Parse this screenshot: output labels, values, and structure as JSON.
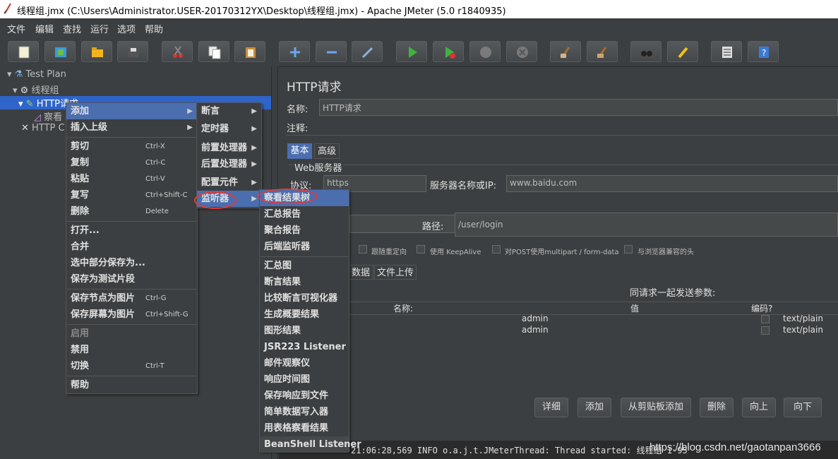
{
  "window": {
    "title": "线程组.jmx (C:\\Users\\Administrator.USER-20170312YX\\Desktop\\线程组.jmx) - Apache JMeter (5.0 r1840935)"
  },
  "menubar": [
    "文件",
    "编辑",
    "查找",
    "运行",
    "选项",
    "帮助"
  ],
  "tree": {
    "test_plan": "Test Plan",
    "thread_group": "线程组",
    "http_request": "HTTP请求",
    "view_results": "察看",
    "http_cookie": "HTTP C"
  },
  "panel": {
    "title": "HTTP请求",
    "name_label": "名称:",
    "name_value": "HTTP请求",
    "comment_label": "注释:",
    "tabs": [
      "基本",
      "高级"
    ],
    "web_server_label": "Web服务器",
    "protocol_label": "协议:",
    "protocol_value": "https",
    "server_label": "服务器名称或IP:",
    "server_value": "www.baidu.com",
    "path_label": "路径:",
    "path_value": "/user/login",
    "checkboxes": [
      "跟随重定向",
      "使用 KeepAlive",
      "对POST使用multipart / form-data",
      "与浏览器兼容的头"
    ],
    "param_tabs": [
      "数据",
      "文件上传"
    ],
    "params_title": "同请求一起发送参数:",
    "columns": [
      "名称:",
      "值",
      "编码?",
      ""
    ],
    "rows": [
      {
        "value": "admin",
        "ctype": "text/plain"
      },
      {
        "value": "admin",
        "ctype": "text/plain"
      }
    ],
    "buttons": [
      "详细",
      "添加",
      "从剪贴板添加",
      "删除",
      "向上",
      "向下"
    ]
  },
  "context_menu": {
    "items": [
      {
        "label": "添加",
        "submenu": true
      },
      {
        "label": "插入上级",
        "submenu": true
      },
      {
        "label": "剪切",
        "shortcut": "Ctrl-X"
      },
      {
        "label": "复制",
        "shortcut": "Ctrl-C"
      },
      {
        "label": "粘贴",
        "shortcut": "Ctrl-V"
      },
      {
        "label": "复写",
        "shortcut": "Ctrl+Shift-C"
      },
      {
        "label": "删除",
        "shortcut": "Delete"
      },
      {
        "label": "打开..."
      },
      {
        "label": "合并"
      },
      {
        "label": "选中部分保存为..."
      },
      {
        "label": "保存为测试片段"
      },
      {
        "label": "保存节点为图片",
        "shortcut": "Ctrl-G"
      },
      {
        "label": "保存屏幕为图片",
        "shortcut": "Ctrl+Shift-G"
      },
      {
        "label": "启用"
      },
      {
        "label": "禁用"
      },
      {
        "label": "切换",
        "shortcut": "Ctrl-T"
      },
      {
        "label": "帮助"
      }
    ]
  },
  "add_menu": {
    "items": [
      "断言",
      "定时器",
      "前置处理器",
      "后置处理器",
      "配置元件",
      "监听器"
    ]
  },
  "listener_menu": {
    "items": [
      "察看结果树",
      "汇总报告",
      "聚合报告",
      "后端监听器",
      "汇总图",
      "断言结果",
      "比较断言可视化器",
      "生成概要结果",
      "图形结果",
      "JSR223 Listener",
      "邮件观察仪",
      "响应时间图",
      "保存响应到文件",
      "简单数据写入器",
      "用表格察看结果",
      "BeanShell Listener"
    ]
  },
  "log": {
    "line1": "21:06:28,569 INFO o.a.j.t.JMeterThread: Thread started: 线程组 1-95",
    "watermark": "https://blog.csdn.net/gaotanpan3666"
  }
}
